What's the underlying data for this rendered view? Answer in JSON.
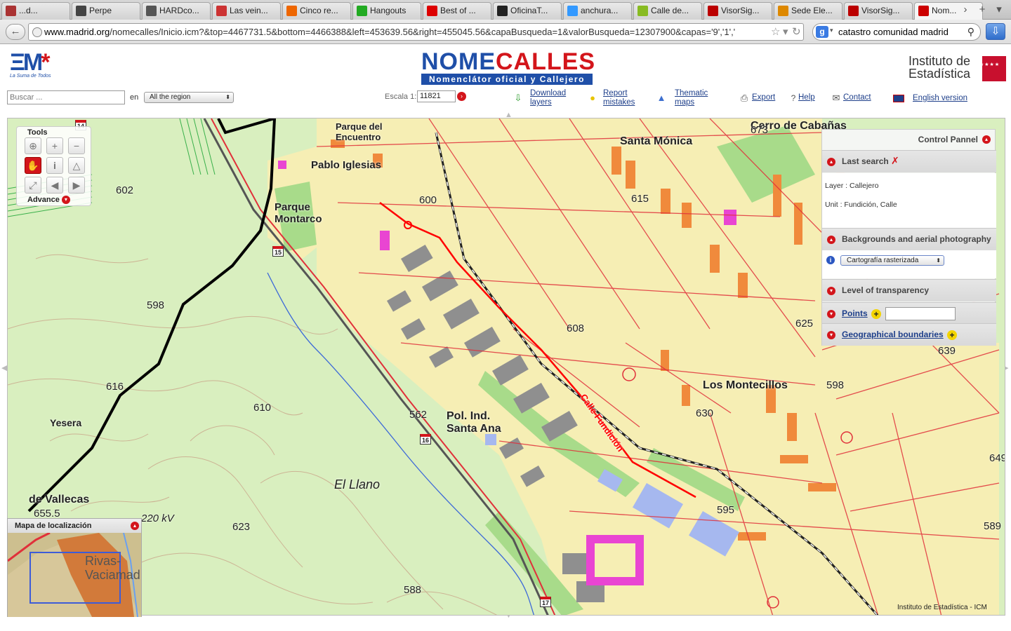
{
  "browser": {
    "tabs": [
      {
        "label": "...d...",
        "color": "#a33"
      },
      {
        "label": "Perpe",
        "color": "#444"
      },
      {
        "label": "HARDco...",
        "color": "#555"
      },
      {
        "label": "Las vein...",
        "color": "#c33"
      },
      {
        "label": "Cinco re...",
        "color": "#e60"
      },
      {
        "label": "Hangouts",
        "color": "#2a2"
      },
      {
        "label": "Best of ...",
        "color": "#d00"
      },
      {
        "label": "OficinaT...",
        "color": "#222"
      },
      {
        "label": "anchura...",
        "color": "#39f"
      },
      {
        "label": "Calle de...",
        "color": "#8b2"
      },
      {
        "label": "VisorSig...",
        "color": "#b00"
      },
      {
        "label": "Sede Ele...",
        "color": "#d80"
      },
      {
        "label": "VisorSig...",
        "color": "#b00"
      },
      {
        "label": "Nom...",
        "color": "#c00"
      }
    ],
    "url_prefix": "www.madrid.org",
    "url_rest": "/nomecalles/Inicio.icm?&top=4467731.5&bottom=4466388&left=453639.56&right=455045.56&capaBusqueda=1&valorBusqueda=12307900&capas='9','1','",
    "search_query": "catastro comunidad madrid"
  },
  "header": {
    "em_tagline": "La Suma de Todos",
    "nc_title_blue": "NOME",
    "nc_title_red": "CALLES",
    "nc_subtitle": "Nomenclátor oficial y Callejero",
    "ie_line1": "Instituto de",
    "ie_line2": "Estadística"
  },
  "options": {
    "search_placeholder": "Buscar ...",
    "en_label": "en",
    "region_value": "All the region",
    "scale_label": "Escala 1:",
    "scale_value": "11821",
    "download_l1": "Download",
    "download_l2": "layers",
    "report_l1": "Report",
    "report_l2": "mistakes",
    "thematic_l1": "Thematic",
    "thematic_l2": "maps",
    "export": "Export",
    "help": "Help",
    "contact": "Contact",
    "english": "English version"
  },
  "tools": {
    "title": "Tools",
    "advance": "Advance"
  },
  "control_panel": {
    "title": "Control Pannel",
    "last_search": "Last search",
    "layer_text": "Layer : Callejero",
    "unit_text": "Unit : Fundición, Calle",
    "backgrounds": "Backgrounds and aerial photography",
    "carto_value": "Cartografía rasterizada",
    "transparency": "Level of transparency",
    "points": "Points",
    "boundaries": "Geographical boundaries"
  },
  "locator": {
    "title": "Mapa de localización",
    "town_line1": "Rivas-",
    "town_line2": "Vaciamad"
  },
  "map": {
    "labels": [
      "Parque del Encuentro",
      "Pablo Iglesias",
      "Parque Montarco",
      "Santa Mónica",
      "Cerro de Cabañas",
      "Los Montecillos",
      "Pol. Ind. Santa Ana",
      "El Llano",
      "Yesera",
      "de Vallecas",
      "Calle Fundición"
    ],
    "spot_heights": [
      "602",
      "598",
      "600",
      "616",
      "610",
      "562",
      "623",
      "588",
      "598",
      "608",
      "625",
      "639",
      "649",
      "595",
      "589",
      "630",
      "673",
      "615",
      "655.5"
    ],
    "km_markers": [
      "15",
      "16",
      "17",
      "14"
    ],
    "power_line": "220 kV"
  },
  "copyright": "Instituto de Estadística - ICM",
  "colors": {
    "accent_red": "#d3151b",
    "brand_blue": "#1f4fa8",
    "map_green": "#d9efbf",
    "urban": "#f6eeb4",
    "building_orange": "#f08a3c",
    "street_red": "#e0303a"
  }
}
